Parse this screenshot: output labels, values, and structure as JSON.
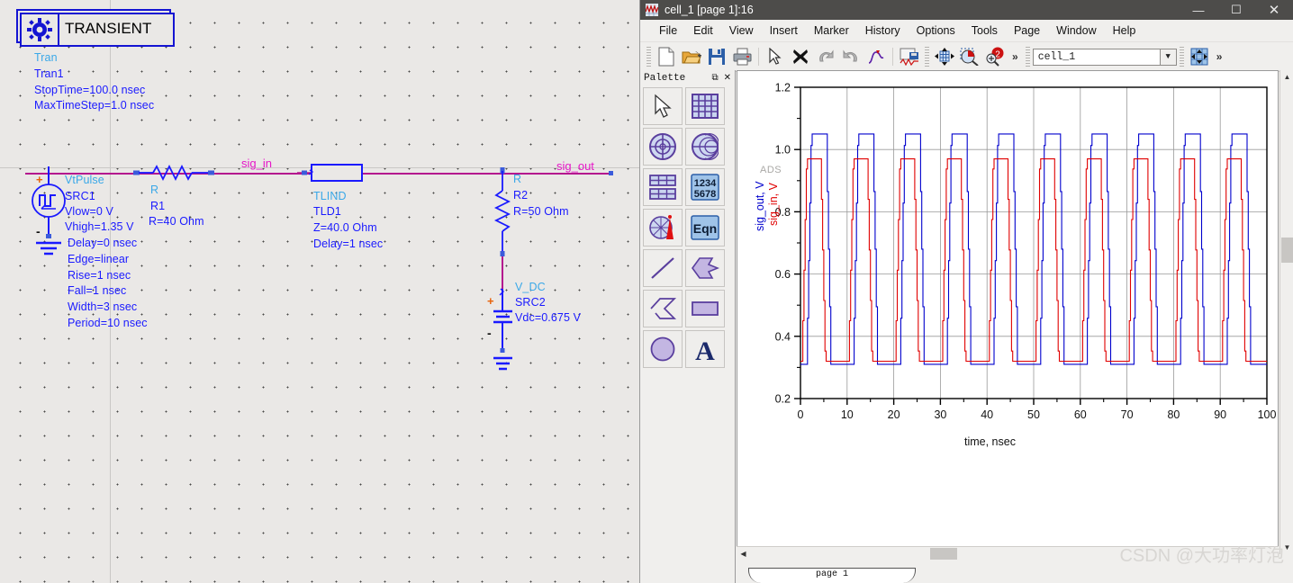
{
  "schematic": {
    "transient_block": {
      "title": "TRANSIENT",
      "icon": "gear-icon",
      "type": "Tran",
      "instance": "Tran1",
      "params": [
        "StopTime=100.0 nsec",
        "MaxTimeStep=1.0 nsec"
      ]
    },
    "source_vtpulse": {
      "type": "VtPulse",
      "instance": "SRC1",
      "params": [
        "Vlow=0 V",
        "Vhigh=1.35 V",
        "Delay=0 nsec",
        "Edge=linear",
        "Rise=1 nsec",
        "Fall=1 nsec",
        "Width=3 nsec",
        "Period=10 nsec"
      ],
      "plus": "+",
      "minus": "-"
    },
    "resistor_r1": {
      "type": "R",
      "instance": "R1",
      "value": "R=40 Ohm"
    },
    "tline": {
      "type": "TLIND",
      "instance": "TLD1",
      "z": "Z=40.0 Ohm",
      "delay": "Delay=1 nsec"
    },
    "resistor_r2": {
      "type": "R",
      "instance": "R2",
      "value": "R=50 Ohm"
    },
    "source_vdc": {
      "type": "V_DC",
      "instance": "SRC2",
      "value": "Vdc=0.675 V",
      "plus": "+",
      "minus": "-"
    },
    "nets": {
      "sig_in": "sig_in",
      "sig_out": "sig_out"
    },
    "colors": {
      "component_blue": "#1a1aff",
      "type_cyan": "#3aa8e8",
      "net_magenta": "#e617c8",
      "wire_magenta": "#b4168e",
      "canvas": "#eae8e6"
    }
  },
  "ads_window": {
    "title": "cell_1 [page 1]:16",
    "title_icon": "waveform-icon",
    "window_buttons": {
      "minimize": "—",
      "maximize": "☐",
      "close": "✕"
    },
    "menus": [
      "File",
      "Edit",
      "View",
      "Insert",
      "Marker",
      "History",
      "Options",
      "Tools",
      "Page",
      "Window",
      "Help"
    ],
    "toolbar": {
      "icons": [
        "new-document-icon",
        "open-folder-icon",
        "save-icon",
        "print-icon",
        "select-arrow-icon",
        "delete-x-icon",
        "undo-icon",
        "redo-icon",
        "curve-icon",
        "simulate-icon",
        "fit-page-icon",
        "zoom-area-icon",
        "zoom-in-icon"
      ],
      "overflow": "»",
      "dataset_value": "cell_1",
      "dataset_arrow": "▼",
      "pan-icon": "pan-icon",
      "overflow2": "»"
    },
    "palette": {
      "title": "Palette",
      "undock": "⧉",
      "close": "✕",
      "items": [
        "arrow-select-icon",
        "rect-plot-icon",
        "polar-plot-icon",
        "smith-chart-icon",
        "list-table-icon",
        "numeric-1234-5678-icon",
        "antenna-pattern-icon",
        "equation-eqn-icon",
        "line-icon",
        "arrow-shape-icon",
        "polyline-icon",
        "rectangle-icon",
        "circle-icon",
        "text-a-icon"
      ],
      "numeric_label_top": "1234",
      "numeric_label_bottom": "5678",
      "eqn_label": "Eqn",
      "text_label": "A"
    },
    "plot_watermark": "ADS",
    "status_tab": "page 1",
    "csdn_watermark": "CSDN @大功率灯泡"
  },
  "chart_data": {
    "type": "line",
    "title": "",
    "xlabel": "time, nsec",
    "ylabel": "sig_out, V / sig_in, V",
    "xlim": [
      0,
      100
    ],
    "ylim": [
      0.2,
      1.2
    ],
    "xticks": [
      0,
      10,
      20,
      30,
      40,
      50,
      60,
      70,
      80,
      90,
      100
    ],
    "yticks": [
      0.2,
      0.4,
      0.6,
      0.8,
      1.0,
      1.2
    ],
    "grid": true,
    "legend": "axis-labels",
    "series": [
      {
        "name": "sig_out, V",
        "color": "#0000cd",
        "high": 1.05,
        "low": 0.31,
        "period": 10,
        "width": 3.2,
        "rise": 1.0,
        "fall": 1.0,
        "delay": 1.3
      },
      {
        "name": "sig_in, V",
        "color": "#e00000",
        "high": 0.97,
        "low": 0.32,
        "period": 10,
        "width": 3.0,
        "rise": 1.0,
        "fall": 1.0,
        "delay": 0.3
      }
    ]
  }
}
